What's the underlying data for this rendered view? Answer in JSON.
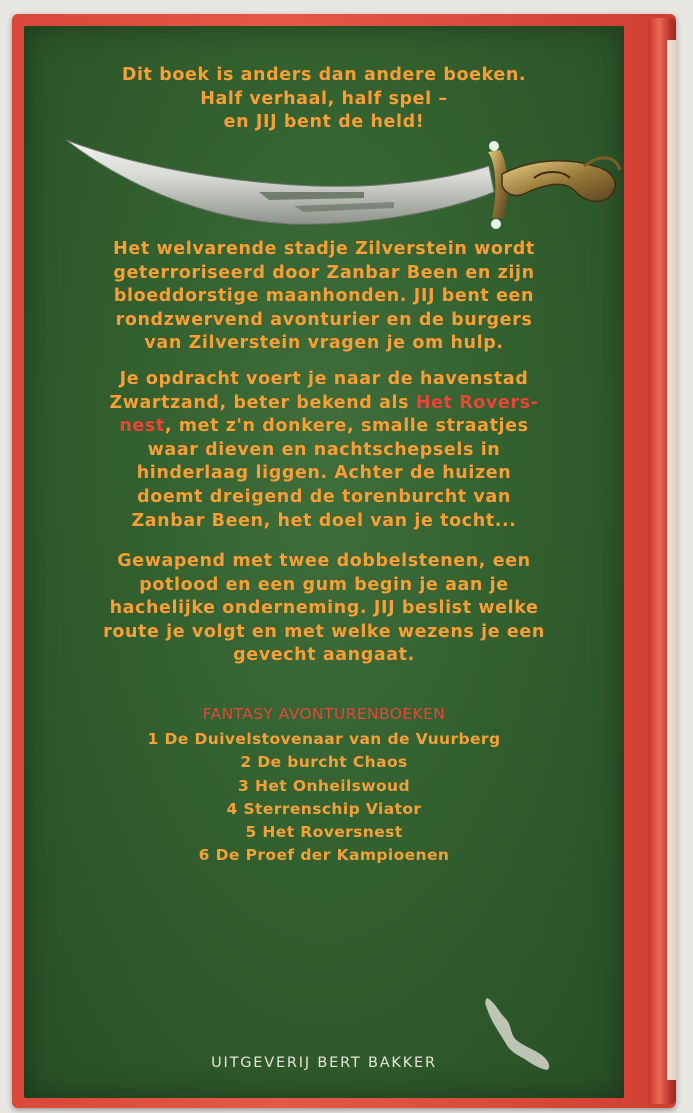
{
  "intro": [
    "Dit boek is anders dan andere boeken.",
    "Half verhaal, half spel –",
    "en JIJ bent de held!"
  ],
  "para1": [
    "Het welvarende stadje Zilverstein wordt",
    "geterroriseerd door Zanbar Been en zijn",
    "bloeddorstige maanhonden. JIJ bent een",
    "rondzwervend avonturier en de burgers",
    "van Zilverstein vragen je om hulp."
  ],
  "para2": {
    "l1": "Je opdracht voert je naar de havenstad",
    "l2a": "Zwartzand, beter bekend als ",
    "l2b": "Het Rovers-",
    "l3a": "nest",
    "l3b": ", met z'n donkere, smalle straatjes",
    "l4": "waar dieven en nachtschepsels in",
    "l5": "hinderlaag liggen. Achter de huizen",
    "l6": "doemt dreigend de torenburcht van",
    "l7": "Zanbar Been, het doel van je tocht..."
  },
  "para3": [
    "Gewapend met twee dobbelstenen, een",
    "potlood en een gum begin je aan je",
    "hachelijke onderneming. JIJ beslist welke",
    "route je volgt en met welke wezens je een",
    "gevecht aangaat."
  ],
  "series": {
    "heading": "FANTASY AVONTURENBOEKEN",
    "items": [
      "1  De Duivelstovenaar van de Vuurberg",
      "2  De burcht Chaos",
      "3  Het Onheilswoud",
      "4  Sterrenschip Viator",
      "5  Het Roversnest",
      "6  De Proef der Kampioenen"
    ]
  },
  "publisher": "UITGEVERIJ BERT BAKKER",
  "colors": {
    "text_orange": "#f2a13a",
    "accent_red": "#e5473a",
    "panel_green": "#33602f",
    "frame_red": "#e55846"
  }
}
